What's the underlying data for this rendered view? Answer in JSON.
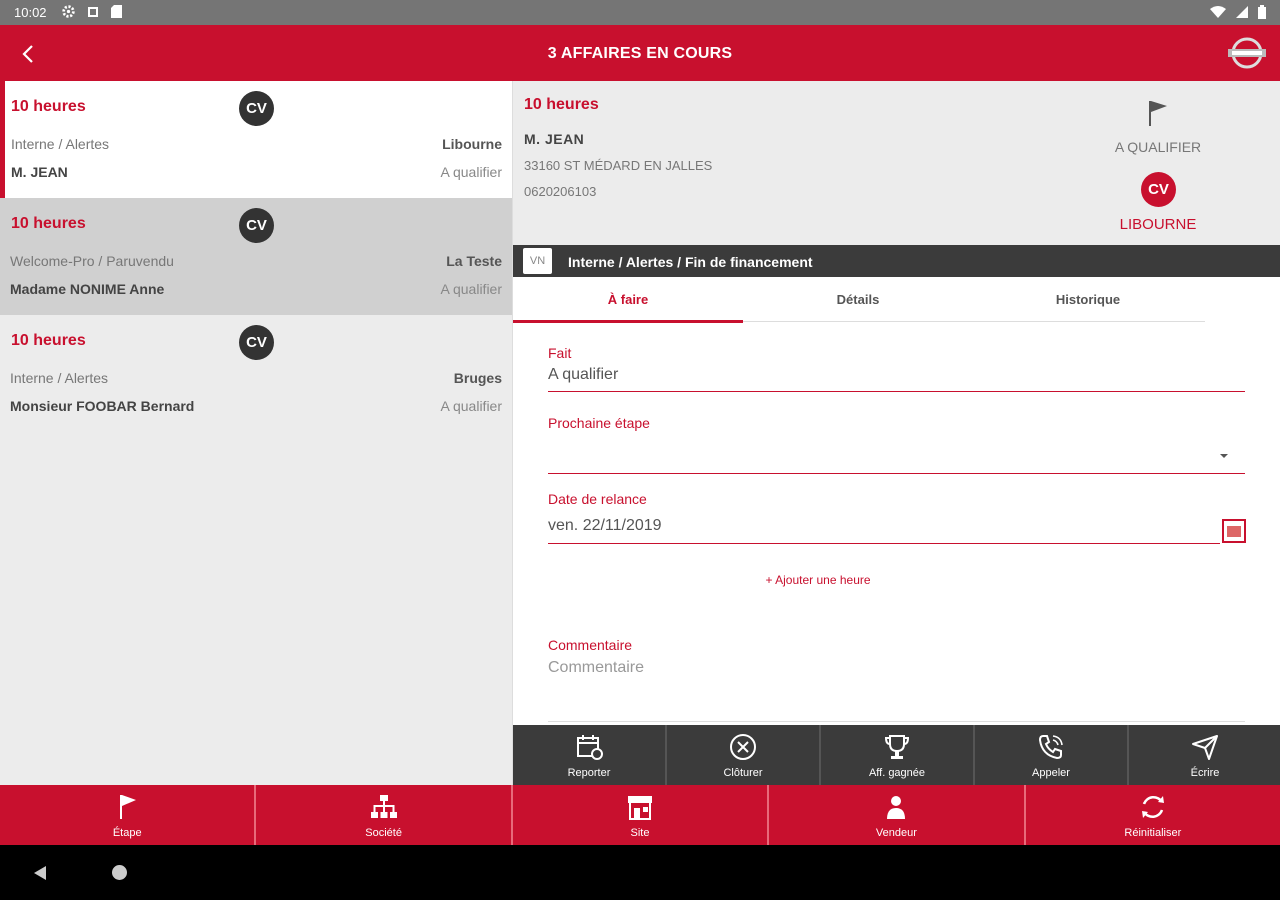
{
  "status_bar": {
    "time": "10:02"
  },
  "app_bar": {
    "title": "3 AFFAIRES EN COURS"
  },
  "list": [
    {
      "hours": "10 heures",
      "badge": "CV",
      "source": "Interne / Alertes",
      "site": "Libourne",
      "name": "M. JEAN",
      "status": "A qualifier"
    },
    {
      "hours": "10 heures",
      "badge": "CV",
      "source": "Welcome-Pro / Paruvendu",
      "site": "La Teste",
      "name": "Madame NONIME Anne",
      "status": "A qualifier"
    },
    {
      "hours": "10 heures",
      "badge": "CV",
      "source": "Interne / Alertes",
      "site": "Bruges",
      "name": "Monsieur FOOBAR Bernard",
      "status": "A qualifier"
    }
  ],
  "detail": {
    "hours": "10 heures",
    "name": "M. JEAN",
    "address": "33160 ST MÉDARD EN JALLES",
    "phone": "0620206103",
    "qualification": "A QUALIFIER",
    "badge": "CV",
    "site": "LIBOURNE",
    "category_tag": "VN",
    "category": "Interne / Alertes / Fin de financement"
  },
  "tabs": [
    "À faire",
    "Détails",
    "Historique"
  ],
  "form": {
    "fait_label": "Fait",
    "fait_value": "A qualifier",
    "next_label": "Prochaine étape",
    "next_value": "",
    "date_label": "Date de relance",
    "date_value": "ven. 22/11/2019",
    "add_hour": "+ Ajouter une heure",
    "comment_label": "Commentaire",
    "comment_placeholder": "Commentaire"
  },
  "actions": [
    "Reporter",
    "Clôturer",
    "Aff. gagnée",
    "Appeler",
    "Écrire"
  ],
  "bottom_nav": [
    "Étape",
    "Société",
    "Site",
    "Vendeur",
    "Réinitialiser"
  ],
  "colors": {
    "brand": "#c8102e",
    "dark": "#3b3b3b"
  }
}
